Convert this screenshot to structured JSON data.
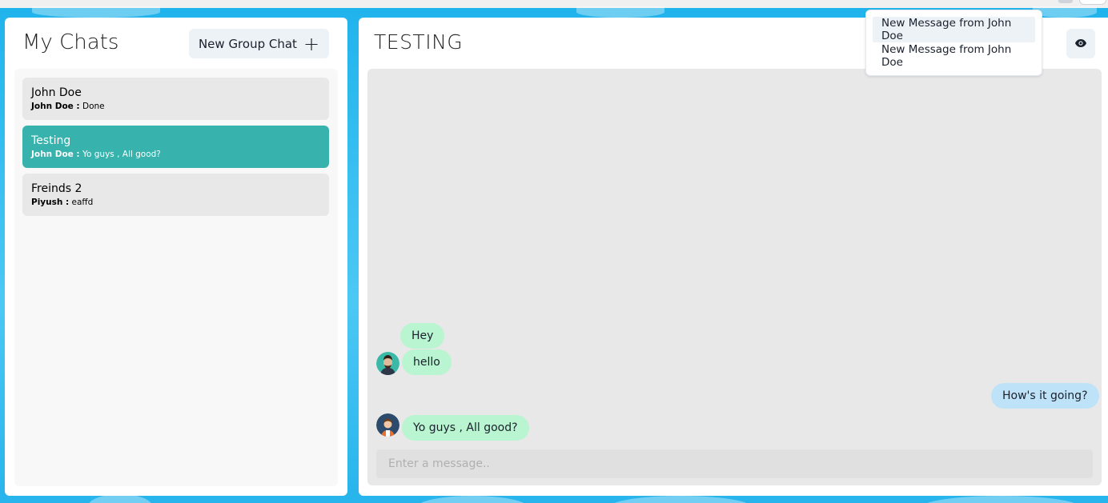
{
  "sidebar": {
    "title": "My Chats",
    "new_group_label": "New Group Chat",
    "chats": [
      {
        "name": "John Doe",
        "sender": "John Doe :",
        "latest": " Done",
        "active": false
      },
      {
        "name": "Testing",
        "sender": "John Doe :",
        "latest": " Yo guys , All good?",
        "active": true
      },
      {
        "name": "Freinds 2",
        "sender": "Piyush :",
        "latest": " eaffd",
        "active": false
      }
    ]
  },
  "chat": {
    "title": "TESTING",
    "messages": [
      {
        "text": "Hey",
        "side": "in",
        "avatar": false
      },
      {
        "text": "hello",
        "side": "in",
        "avatar": true
      },
      {
        "text": "How's it going?",
        "side": "out",
        "avatar": false
      },
      {
        "text": "Yo guys , All good?",
        "side": "in",
        "avatar": true
      }
    ],
    "input_placeholder": "Enter a message.."
  },
  "notifications": {
    "items": [
      "New Message from John Doe",
      "New Message from John Doe"
    ]
  },
  "colors": {
    "accent": "#38b2ac",
    "incoming_bubble": "#b9f5d0",
    "outgoing_bubble": "#bee3f8",
    "background": "#2ab8ee"
  },
  "icons": {
    "new_group": "plus-icon",
    "view_profile": "eye-icon"
  }
}
